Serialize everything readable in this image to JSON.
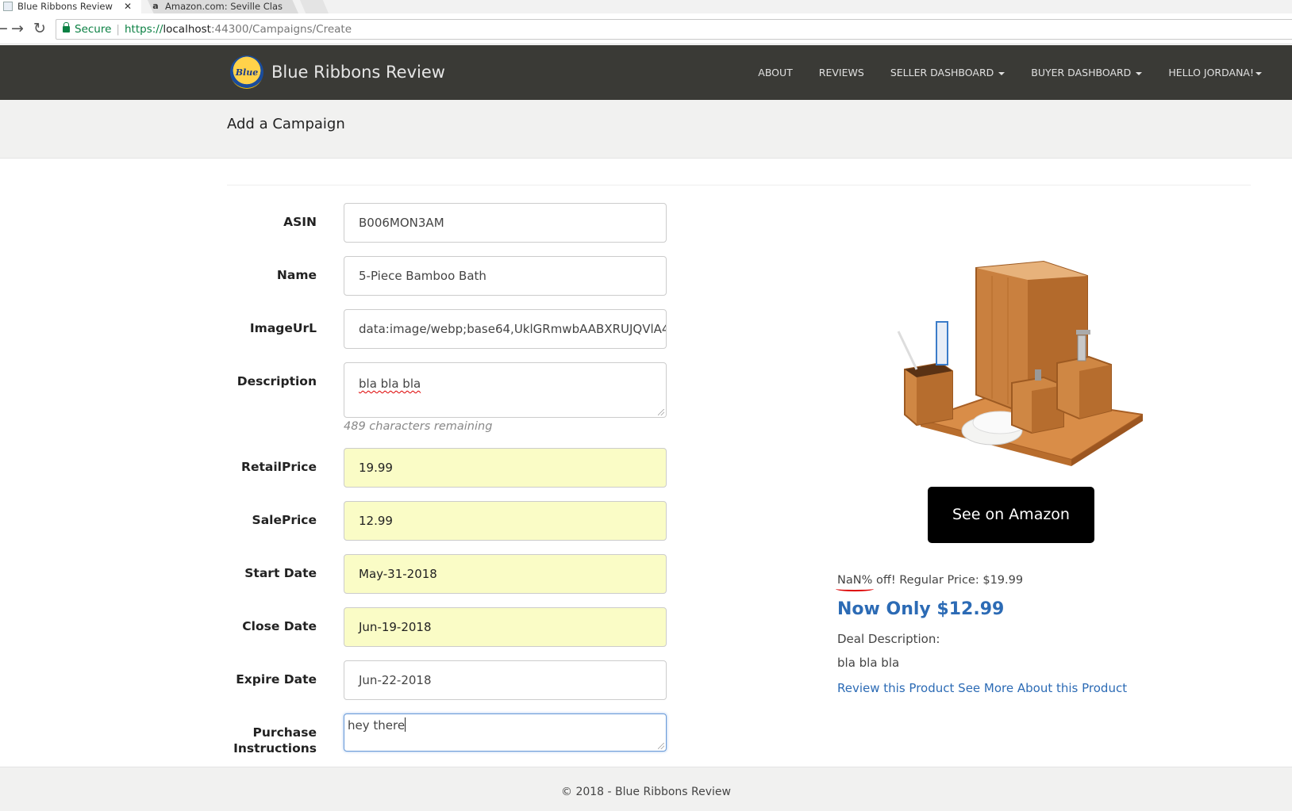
{
  "browser": {
    "tabs": [
      {
        "title": "Blue Ribbons Review",
        "close": "✕"
      },
      {
        "title": "Amazon.com: Seville Clas",
        "favicon": "a"
      }
    ],
    "secure_label": "Secure",
    "url_scheme": "https://",
    "url_host": "localhost",
    "url_path": ":44300/Campaigns/Create",
    "back_icon": "←",
    "forward_icon": "→",
    "reload_icon": "↻"
  },
  "navbar": {
    "brand": "Blue Ribbons Review",
    "logo_text": "Blue",
    "links": [
      "ABOUT",
      "REVIEWS",
      "SELLER DASHBOARD",
      "BUYER DASHBOARD",
      "HELLO JORDANA!"
    ]
  },
  "page": {
    "title": "Add a Campaign"
  },
  "form": {
    "asin_label": "ASIN",
    "asin_value": "B006MON3AM",
    "name_label": "Name",
    "name_value": "5-Piece Bamboo Bath",
    "imageurl_label": "ImageUrL",
    "imageurl_value": "data:image/webp;base64,UklGRmwbAABXRUJQVlA4",
    "description_label": "Description",
    "description_value": "bla bla bla",
    "description_help": "489 characters remaining",
    "retail_label": "RetailPrice",
    "retail_value": "19.99",
    "sale_label": "SalePrice",
    "sale_value": "12.99",
    "start_label": "Start Date",
    "start_value": "May-31-2018",
    "close_label": "Close Date",
    "close_value": "Jun-19-2018",
    "expire_label": "Expire Date",
    "expire_value": "Jun-22-2018",
    "purchase_label_1": "Purchase",
    "purchase_label_2": "Instructions",
    "purchase_value": "hey there"
  },
  "product": {
    "amazon_button": "See on Amazon",
    "off_nan": "NaN%",
    "off_rest": " off! Regular Price: $19.99",
    "now_only": "Now Only $12.99",
    "deal_desc_label": "Deal Description:",
    "deal_desc": "bla bla bla",
    "review_link": "Review this Product",
    "more_link": "See More About this Product"
  },
  "footer": {
    "text": "© 2018 - Blue Ribbons Review"
  },
  "colors": {
    "navbar_bg": "#3a3a36",
    "link_blue": "#2c6bb5",
    "autofill_yellow": "#fafcc6",
    "button_black": "#000000"
  }
}
